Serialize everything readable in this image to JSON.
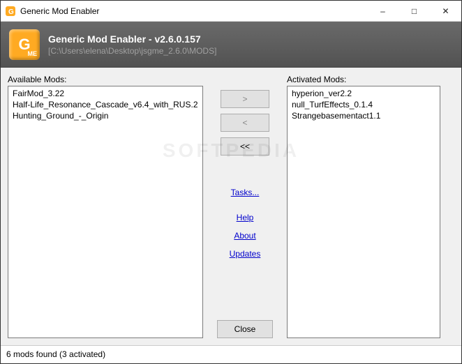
{
  "window": {
    "title": "Generic Mod Enabler"
  },
  "header": {
    "app_title": "Generic Mod Enabler - v2.6.0.157",
    "path": "[C:\\Users\\elena\\Desktop\\jsgme_2.6.0\\MODS]"
  },
  "labels": {
    "available": "Available Mods:",
    "activated": "Activated Mods:"
  },
  "available_mods": [
    "FairMod_3.22",
    "Half-Life_Resonance_Cascade_v6.4_with_RUS.2",
    "Hunting_Ground_-_Origin"
  ],
  "activated_mods": [
    "hyperion_ver2.2",
    "null_TurfEffects_0.1.4",
    "Strangebasementact1.1"
  ],
  "buttons": {
    "activate": ">",
    "deactivate": "<",
    "deactivate_all": "<<",
    "close": "Close"
  },
  "links": {
    "tasks": "Tasks...",
    "help": "Help",
    "about": "About",
    "updates": "Updates"
  },
  "status": "6 mods found (3 activated)",
  "watermark": "SOFTPEDIA"
}
